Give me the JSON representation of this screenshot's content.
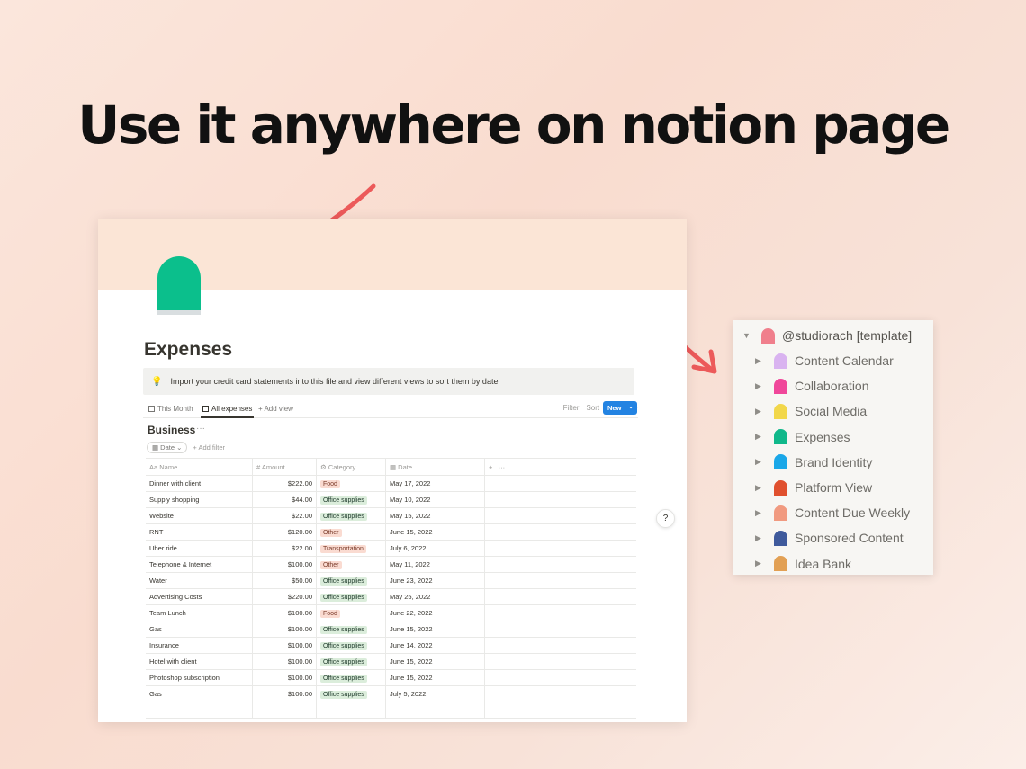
{
  "headline": "Use it anywhere on notion page",
  "page": {
    "title": "Expenses",
    "callout": "Import your credit card statements into this file and view different views to sort them by date",
    "views": [
      "This Month",
      "All expenses"
    ],
    "add_view": "+ Add view",
    "toolbar": {
      "filter": "Filter",
      "sort": "Sort",
      "new": "New"
    },
    "group_title": "Business",
    "filter_chip": "Date",
    "add_filter": "+ Add filter",
    "columns": [
      "Name",
      "Amount",
      "Category",
      "Date"
    ],
    "rows": [
      {
        "name": "Dinner with client",
        "amount": "$222.00",
        "category": "Food",
        "date": "May 17, 2022"
      },
      {
        "name": "Supply shopping",
        "amount": "$44.00",
        "category": "Office supplies",
        "date": "May 10, 2022"
      },
      {
        "name": "Website",
        "amount": "$22.00",
        "category": "Office supplies",
        "date": "May 15, 2022"
      },
      {
        "name": "RNT",
        "amount": "$120.00",
        "category": "Other",
        "date": "June 15, 2022"
      },
      {
        "name": "Uber ride",
        "amount": "$22.00",
        "category": "Transportation",
        "date": "July 6, 2022"
      },
      {
        "name": "Telephone & Internet",
        "amount": "$100.00",
        "category": "Other",
        "date": "May 11, 2022"
      },
      {
        "name": "Water",
        "amount": "$50.00",
        "category": "Office supplies",
        "date": "June 23, 2022"
      },
      {
        "name": "Advertising Costs",
        "amount": "$220.00",
        "category": "Office supplies",
        "date": "May 25, 2022"
      },
      {
        "name": "Team Lunch",
        "amount": "$100.00",
        "category": "Food",
        "date": "June 22, 2022"
      },
      {
        "name": "Gas",
        "amount": "$100.00",
        "category": "Office supplies",
        "date": "June 15, 2022"
      },
      {
        "name": "Insurance",
        "amount": "$100.00",
        "category": "Office supplies",
        "date": "June 14, 2022"
      },
      {
        "name": "Hotel with client",
        "amount": "$100.00",
        "category": "Office supplies",
        "date": "June 15, 2022"
      },
      {
        "name": "Photoshop subscription",
        "amount": "$100.00",
        "category": "Office supplies",
        "date": "June 15, 2022"
      },
      {
        "name": "Gas",
        "amount": "$100.00",
        "category": "Office supplies",
        "date": "July 5, 2022"
      }
    ],
    "help": "?"
  },
  "sidebar": {
    "root": {
      "label": "@studiorach [template]",
      "color": "#f07f8c"
    },
    "items": [
      {
        "label": "Content Calendar",
        "color": "#d9b3f0"
      },
      {
        "label": "Collaboration",
        "color": "#f0479a"
      },
      {
        "label": "Social Media",
        "color": "#f2d74a"
      },
      {
        "label": "Expenses",
        "color": "#10b88a"
      },
      {
        "label": "Brand Identity",
        "color": "#1aa7e8"
      },
      {
        "label": "Platform View",
        "color": "#e0502e"
      },
      {
        "label": "Content Due Weekly",
        "color": "#f19a80"
      },
      {
        "label": "Sponsored Content",
        "color": "#3f5a9c"
      },
      {
        "label": "Idea Bank",
        "color": "#e2a054"
      }
    ]
  },
  "colors": {
    "accent": "#2383e2",
    "arrow": "#ec5a5a"
  }
}
